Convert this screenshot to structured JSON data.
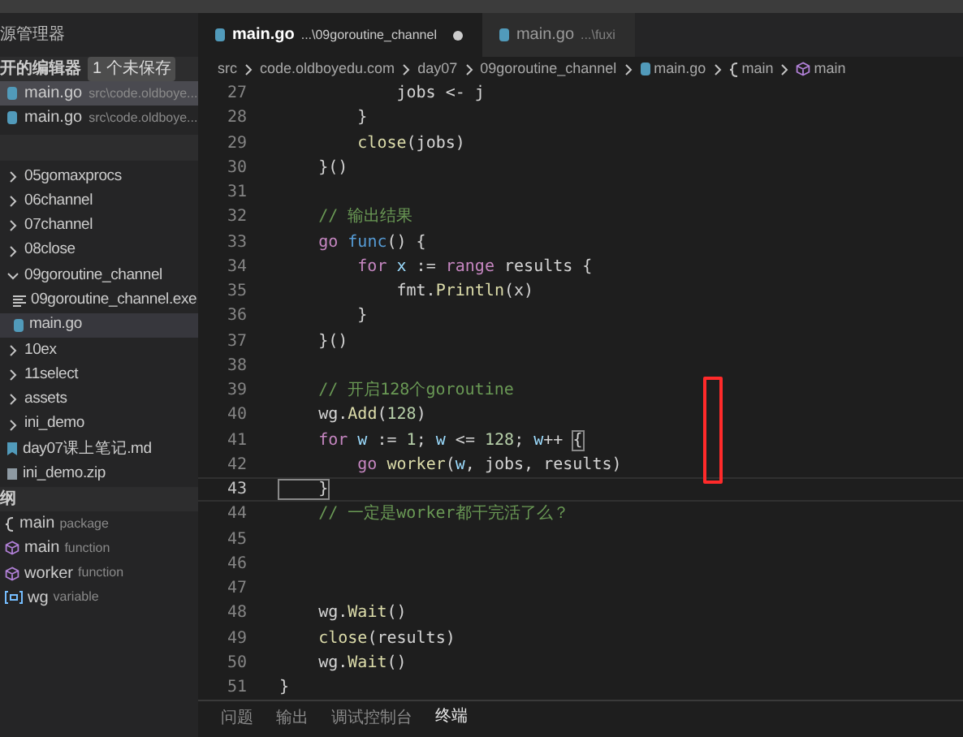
{
  "sidebar": {
    "title": "源管理器",
    "open_editors": {
      "title": "开的编辑器",
      "badge": "1 个未保存",
      "items": [
        {
          "name": "main.go",
          "path": "src\\code.oldboye...",
          "selected": true
        },
        {
          "name": "main.go",
          "path": "src\\code.oldboye...",
          "selected": false
        }
      ]
    },
    "tree": [
      {
        "name": "05gomaxprocs",
        "kind": "folder",
        "expanded": false,
        "selected": false
      },
      {
        "name": "06channel",
        "kind": "folder",
        "expanded": false,
        "selected": false
      },
      {
        "name": "07channel",
        "kind": "folder",
        "expanded": false,
        "selected": false
      },
      {
        "name": "08close",
        "kind": "folder",
        "expanded": false,
        "selected": false
      },
      {
        "name": "09goroutine_channel",
        "kind": "folder",
        "expanded": true,
        "selected": false,
        "children": [
          {
            "name": "09goroutine_channel.exe",
            "kind": "exe",
            "selected": false
          },
          {
            "name": "main.go",
            "kind": "go",
            "selected": true
          }
        ]
      },
      {
        "name": "10ex",
        "kind": "folder",
        "expanded": false,
        "selected": false
      },
      {
        "name": "11select",
        "kind": "folder",
        "expanded": false,
        "selected": false
      },
      {
        "name": "assets",
        "kind": "folder",
        "expanded": false,
        "selected": false
      },
      {
        "name": "ini_demo",
        "kind": "folder",
        "expanded": false,
        "selected": false
      },
      {
        "name": "day07课上笔记.md",
        "kind": "md",
        "selected": false
      },
      {
        "name": "ini_demo.zip",
        "kind": "zip",
        "selected": false
      }
    ],
    "outline": {
      "title": "纲",
      "items": [
        {
          "name": "main",
          "type": "package",
          "kind": "module"
        },
        {
          "name": "main",
          "type": "function",
          "kind": "function"
        },
        {
          "name": "worker",
          "type": "function",
          "kind": "function"
        },
        {
          "name": "wg",
          "type": "variable",
          "kind": "variable"
        }
      ]
    }
  },
  "tabs": [
    {
      "label": "main.go",
      "path": "...\\09goroutine_channel",
      "selected": true,
      "dirty": true
    },
    {
      "label": "main.go",
      "path": "...\\fuxi",
      "selected": false,
      "dirty": false
    }
  ],
  "breadcrumbs": [
    {
      "text": "src",
      "kind": "folder"
    },
    {
      "text": "code.oldboyedu.com",
      "kind": "folder"
    },
    {
      "text": "day07",
      "kind": "folder"
    },
    {
      "text": "09goroutine_channel",
      "kind": "folder"
    },
    {
      "text": "main.go",
      "kind": "file"
    },
    {
      "text": "main",
      "kind": "module"
    },
    {
      "text": "main",
      "kind": "function"
    }
  ],
  "code": [
    {
      "number": "27",
      "current": false,
      "tokens": [
        {
          "text": "            jobs <- j",
          "kind": "plain"
        }
      ]
    },
    {
      "number": "28",
      "current": false,
      "tokens": [
        {
          "text": "        }",
          "kind": "plain"
        }
      ]
    },
    {
      "number": "29",
      "current": false,
      "tokens": [
        {
          "text": "        close",
          "kind": "func"
        },
        {
          "text": "(jobs)",
          "kind": "plain"
        }
      ]
    },
    {
      "number": "30",
      "current": false,
      "tokens": [
        {
          "text": "    }()",
          "kind": "plain"
        }
      ]
    },
    {
      "number": "31",
      "current": false
    },
    {
      "number": "32",
      "current": false,
      "tokens": [
        {
          "text": "    // 输出结果",
          "kind": "comment"
        }
      ]
    },
    {
      "number": "33",
      "current": false,
      "tokens": [
        {
          "text": "    go ",
          "kind": "keyword"
        },
        {
          "text": "func",
          "kind": "storage"
        },
        {
          "text": "() {",
          "kind": "plain"
        }
      ]
    },
    {
      "number": "34",
      "current": false,
      "tokens": [
        {
          "text": "        for ",
          "kind": "keyword"
        },
        {
          "text": "x",
          "kind": "var"
        },
        {
          "text": " := ",
          "kind": "plain"
        },
        {
          "text": "range",
          "kind": "keyword"
        },
        {
          "text": " results {",
          "kind": "plain"
        }
      ]
    },
    {
      "number": "35",
      "current": false,
      "tokens": [
        {
          "text": "            fmt.",
          "kind": "plain"
        },
        {
          "text": "Println",
          "kind": "func"
        },
        {
          "text": "(x)",
          "kind": "plain"
        }
      ]
    },
    {
      "number": "36",
      "current": false,
      "tokens": [
        {
          "text": "        }",
          "kind": "plain"
        }
      ]
    },
    {
      "number": "37",
      "current": false,
      "tokens": [
        {
          "text": "    }()",
          "kind": "plain"
        }
      ]
    },
    {
      "number": "38",
      "current": false
    },
    {
      "number": "39",
      "current": false,
      "tokens": [
        {
          "text": "    // 开启128个goroutine",
          "kind": "comment"
        }
      ]
    },
    {
      "number": "40",
      "current": false,
      "tokens": [
        {
          "text": "    wg.",
          "kind": "plain"
        },
        {
          "text": "Add",
          "kind": "func"
        },
        {
          "text": "(",
          "kind": "plain"
        },
        {
          "text": "128",
          "kind": "number"
        },
        {
          "text": ")",
          "kind": "plain"
        }
      ]
    },
    {
      "number": "41",
      "current": false,
      "tokens": [
        {
          "text": "    for ",
          "kind": "keyword"
        },
        {
          "text": "w",
          "kind": "var"
        },
        {
          "text": " := ",
          "kind": "plain"
        },
        {
          "text": "1",
          "kind": "number"
        },
        {
          "text": "; ",
          "kind": "plain"
        },
        {
          "text": "w",
          "kind": "var"
        },
        {
          "text": " <= ",
          "kind": "plain"
        },
        {
          "text": "128",
          "kind": "number"
        },
        {
          "text": "; ",
          "kind": "plain"
        },
        {
          "text": "w",
          "kind": "var"
        },
        {
          "text": "++ ",
          "kind": "plain"
        },
        {
          "text": "{",
          "kind": "bracket"
        }
      ]
    },
    {
      "number": "42",
      "current": false,
      "tokens": [
        {
          "text": "        go ",
          "kind": "keyword"
        },
        {
          "text": "worker",
          "kind": "func"
        },
        {
          "text": "(",
          "kind": "plain"
        },
        {
          "text": "w",
          "kind": "var"
        },
        {
          "text": ", jobs, results)",
          "kind": "plain"
        }
      ]
    },
    {
      "number": "43",
      "current": true,
      "tokens": [
        {
          "text": "    }",
          "kind": "bracket"
        }
      ]
    },
    {
      "number": "44",
      "current": false,
      "tokens": [
        {
          "text": "    // 一定是worker都干完活了么？",
          "kind": "comment"
        }
      ]
    },
    {
      "number": "45",
      "current": false
    },
    {
      "number": "46",
      "current": false
    },
    {
      "number": "47",
      "current": false
    },
    {
      "number": "48",
      "current": false,
      "tokens": [
        {
          "text": "    wg.",
          "kind": "plain"
        },
        {
          "text": "Wait",
          "kind": "func"
        },
        {
          "text": "()",
          "kind": "plain"
        }
      ]
    },
    {
      "number": "49",
      "current": false,
      "tokens": [
        {
          "text": "    close",
          "kind": "func"
        },
        {
          "text": "(results)",
          "kind": "plain"
        }
      ]
    },
    {
      "number": "50",
      "current": false,
      "tokens": [
        {
          "text": "    wg.",
          "kind": "plain"
        },
        {
          "text": "Wait",
          "kind": "func"
        },
        {
          "text": "()",
          "kind": "plain"
        }
      ]
    },
    {
      "number": "51",
      "current": false,
      "tokens": [
        {
          "text": "}",
          "kind": "plain"
        }
      ]
    }
  ],
  "panel_tabs": [
    {
      "label": "问题",
      "selected": false
    },
    {
      "label": "输出",
      "selected": false
    },
    {
      "label": "调试控制台",
      "selected": false
    },
    {
      "label": "终端",
      "selected": true
    }
  ]
}
